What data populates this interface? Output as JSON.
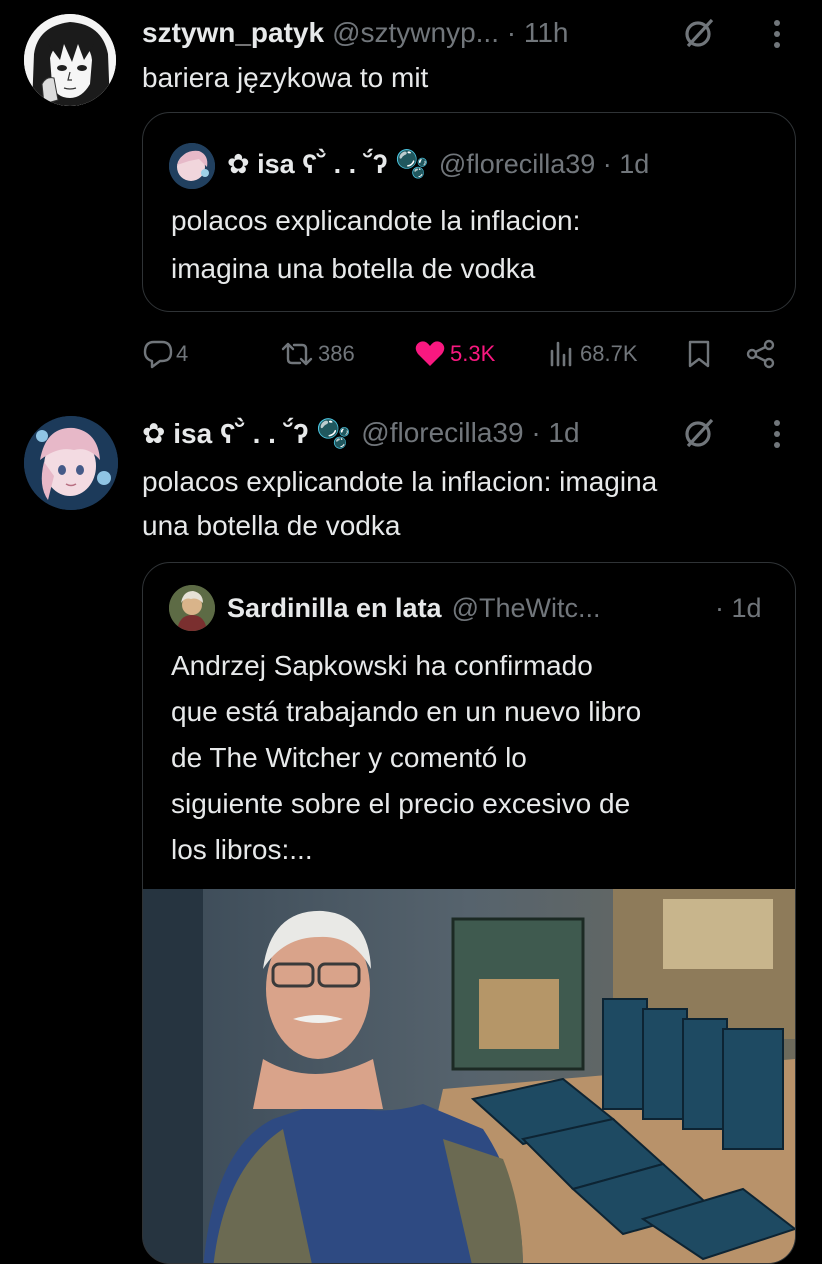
{
  "tweet1": {
    "display_name": "sztywn_patyk",
    "handle_time": "@sztywnyp... · 11h",
    "text": "bariera językowa to mit",
    "quote": {
      "display_name": "✿ isa ʕ˘̀ . . ˘́ʔ 🫧",
      "handle_time": "@florecilla39 · 1d",
      "lines": [
        "polacos explicandote la inflacion:",
        "imagina una botella de vodka"
      ]
    },
    "actions": {
      "replies": "4",
      "reposts": "386",
      "likes": "5.3K",
      "views": "68.7K"
    }
  },
  "tweet2": {
    "display_name": "✿ isa ʕ˘̀ . . ˘́ʔ 🫧",
    "handle_time": "@florecilla39 · 1d",
    "lines": [
      "polacos explicandote la inflacion: imagina",
      "una botella de vodka"
    ],
    "quote": {
      "display_name": "Sardinilla en lata",
      "handle": "@TheWitc...",
      "time": "· 1d",
      "lines": [
        "Andrzej Sapkowski ha confirmado",
        "que está trabajando en un nuevo libro",
        "de The Witcher y comentó lo",
        "siguiente sobre el precio excesivo de",
        "los libros:..."
      ]
    }
  },
  "colors": {
    "background": "#000000",
    "text": "#e7e9ea",
    "muted": "#71767b",
    "like": "#f91880",
    "border": "#2f3336"
  },
  "icons": [
    "grok-icon",
    "more-icon",
    "reply-icon",
    "repost-icon",
    "heart-icon",
    "views-icon",
    "bookmark-icon",
    "share-icon"
  ]
}
